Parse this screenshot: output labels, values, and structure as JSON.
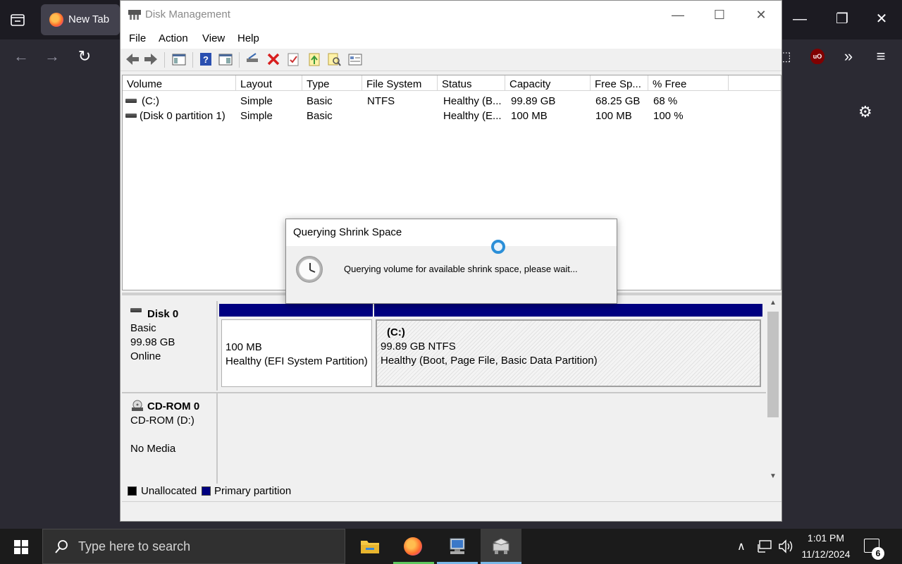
{
  "browser": {
    "tab_label": "New Tab"
  },
  "window": {
    "title": "Disk Management",
    "menu": [
      "File",
      "Action",
      "View",
      "Help"
    ]
  },
  "volume_list": {
    "columns": [
      "Volume",
      "Layout",
      "Type",
      "File System",
      "Status",
      "Capacity",
      "Free Sp...",
      "% Free"
    ],
    "rows": [
      {
        "volume": "(C:)",
        "layout": "Simple",
        "type": "Basic",
        "fs": "NTFS",
        "status": "Healthy (B...",
        "capacity": "99.89 GB",
        "free": "68.25 GB",
        "pct": "68 %"
      },
      {
        "volume": "(Disk 0 partition 1)",
        "layout": "Simple",
        "type": "Basic",
        "fs": "",
        "status": "Healthy (E...",
        "capacity": "100 MB",
        "free": "100 MB",
        "pct": "100 %"
      }
    ]
  },
  "disks": [
    {
      "name": "Disk 0",
      "type": "Basic",
      "size": "99.98 GB",
      "state": "Online",
      "partitions": [
        {
          "name": "",
          "size": "100 MB",
          "status": "Healthy (EFI System Partition)"
        },
        {
          "name": "(C:)",
          "size": "99.89 GB NTFS",
          "status": "Healthy (Boot, Page File, Basic Data Partition)"
        }
      ]
    },
    {
      "name": "CD-ROM 0",
      "type": "CD-ROM (D:)",
      "state": "No Media"
    }
  ],
  "legend": {
    "unallocated": "Unallocated",
    "primary": "Primary partition",
    "colors": {
      "unallocated": "#000000",
      "primary": "#000080"
    }
  },
  "dialog": {
    "title": "Querying Shrink Space",
    "message": "Querying volume for available shrink space, please wait..."
  },
  "taskbar": {
    "search_placeholder": "Type here to search",
    "time": "1:01 PM",
    "date": "11/12/2024",
    "notification_count": "6"
  }
}
